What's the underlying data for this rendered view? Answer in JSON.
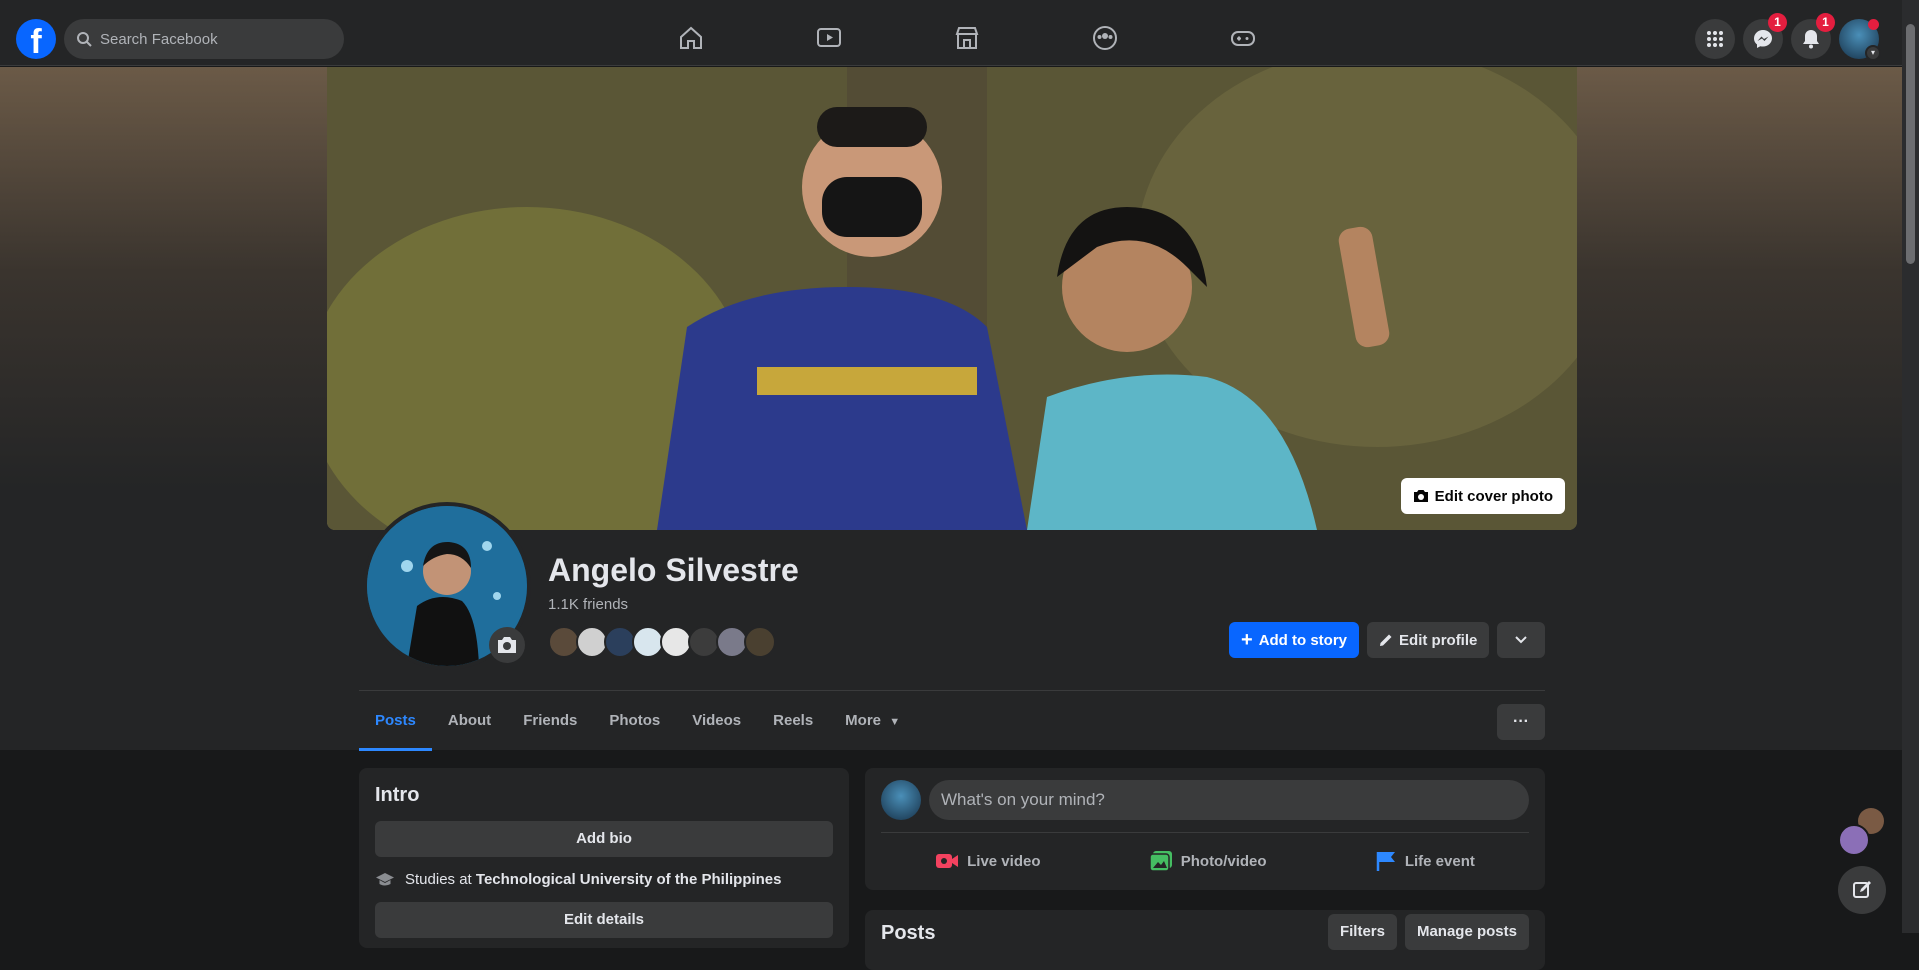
{
  "topbar": {
    "logo_letter": "f",
    "search_placeholder": "Search Facebook",
    "nav": [
      "home-icon",
      "video-icon",
      "marketplace-icon",
      "groups-icon",
      "gaming-icon"
    ],
    "badges": {
      "messenger": "1",
      "notifications": "1"
    }
  },
  "profile": {
    "name": "Angelo Silvestre",
    "friends_count": "1.1K friends",
    "edit_cover_label": "Edit cover photo",
    "add_story_label": "Add to story",
    "edit_profile_label": "Edit profile"
  },
  "tabs": [
    {
      "label": "Posts",
      "active": true
    },
    {
      "label": "About"
    },
    {
      "label": "Friends"
    },
    {
      "label": "Photos"
    },
    {
      "label": "Videos"
    },
    {
      "label": "Reels"
    },
    {
      "label": "More"
    }
  ],
  "intro": {
    "title": "Intro",
    "add_bio": "Add bio",
    "studies_prefix": "Studies at",
    "school": "Technological University of the Philippines",
    "edit_details": "Edit details"
  },
  "composer": {
    "placeholder": "What's on your mind?",
    "live": "Live video",
    "photo": "Photo/video",
    "life": "Life event"
  },
  "posts_card": {
    "title": "Posts",
    "filters": "Filters",
    "manage": "Manage posts"
  },
  "colors": {
    "accent": "#0866ff",
    "tab_active": "#2d88ff",
    "background": "#18191a",
    "surface": "#242526",
    "badge": "#e41e3f"
  }
}
